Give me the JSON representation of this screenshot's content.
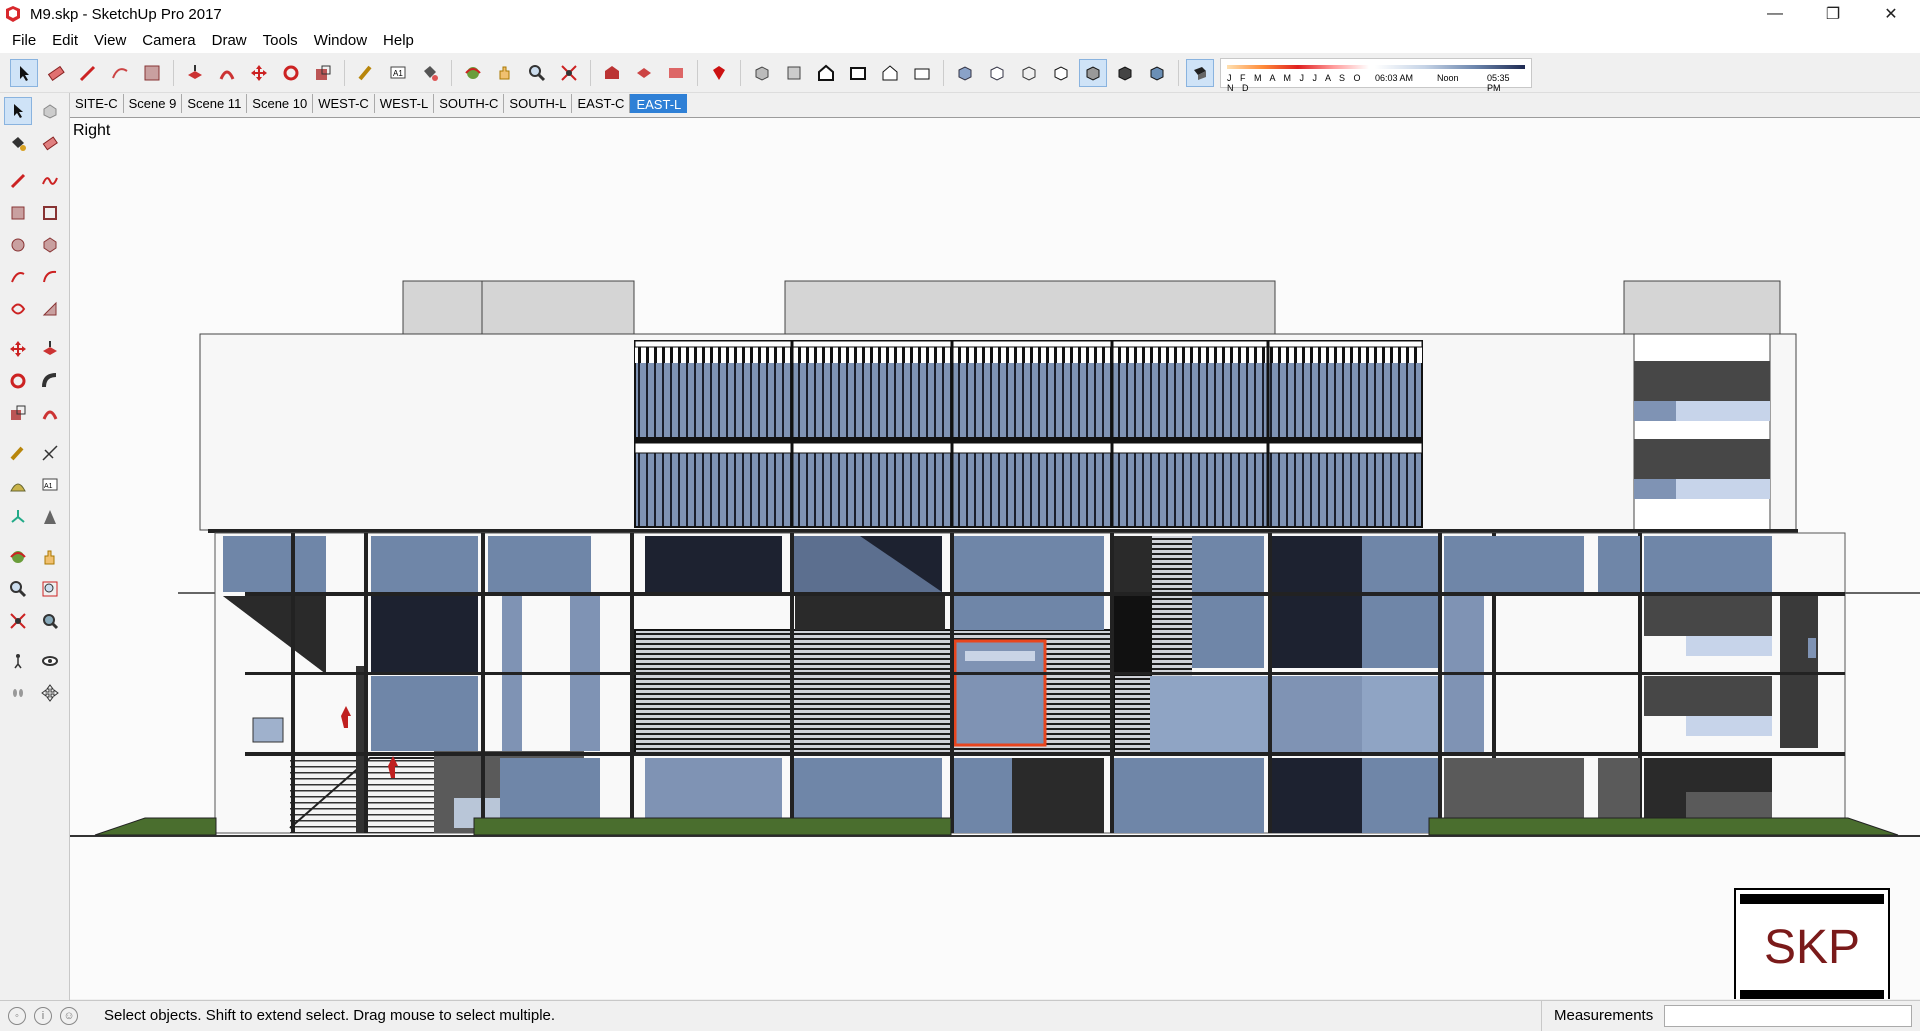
{
  "window": {
    "title": "M9.skp - SketchUp Pro 2017"
  },
  "menu": [
    "File",
    "Edit",
    "View",
    "Camera",
    "Draw",
    "Tools",
    "Window",
    "Help"
  ],
  "scenes": [
    "SITE-C",
    "Scene 9",
    "Scene 11",
    "Scene 10",
    "WEST-C",
    "WEST-L",
    "SOUTH-C",
    "SOUTH-L",
    "EAST-C",
    "EAST-L"
  ],
  "active_scene": "EAST-L",
  "shadows": {
    "months_label": "J F M A M J J A S O N D",
    "time_start": "06:03 AM",
    "time_mid": "Noon",
    "time_end": "05:35 PM"
  },
  "viewport": {
    "view_label": "Right"
  },
  "logo": {
    "text": "SKP"
  },
  "status": {
    "message": "Select objects. Shift to extend select. Drag mouse to select multiple.",
    "measurements_label": "Measurements",
    "measurements_value": ""
  },
  "colors": {
    "accent": "#2f80d6",
    "selection": "#e8451e",
    "glass": "#6f86a8"
  }
}
